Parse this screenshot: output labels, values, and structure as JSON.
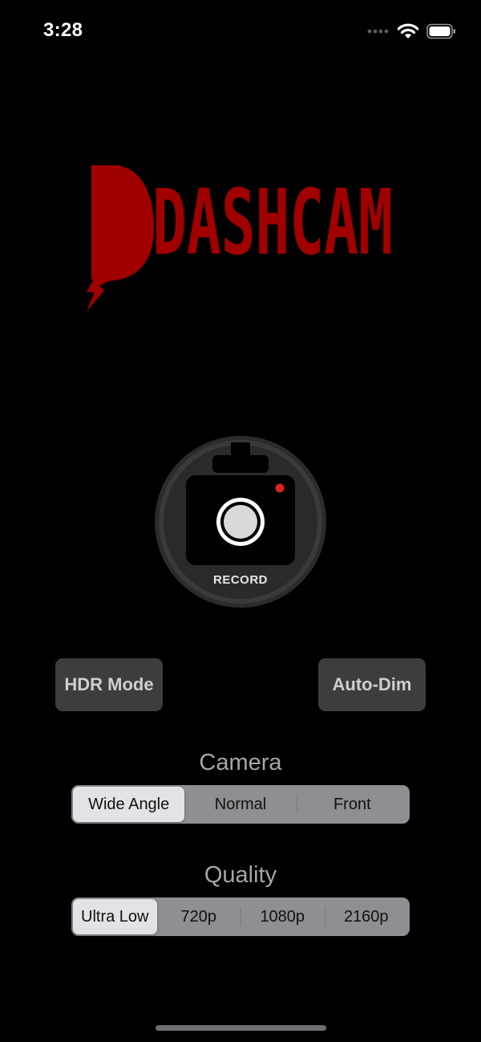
{
  "status_bar": {
    "time": "3:28"
  },
  "logo": {
    "text": "DASHCAM"
  },
  "record": {
    "label": "RECORD"
  },
  "toggles": {
    "hdr_label": "HDR Mode",
    "autodim_label": "Auto-Dim"
  },
  "camera": {
    "title": "Camera",
    "options": [
      "Wide Angle",
      "Normal",
      "Front"
    ],
    "selected": "Wide Angle"
  },
  "quality": {
    "title": "Quality",
    "options": [
      "Ultra Low",
      "720p",
      "1080p",
      "2160p"
    ],
    "selected": "Ultra Low"
  },
  "colors": {
    "brand_red": "#a10000",
    "record_dot": "#e0201c",
    "background": "#000000"
  }
}
